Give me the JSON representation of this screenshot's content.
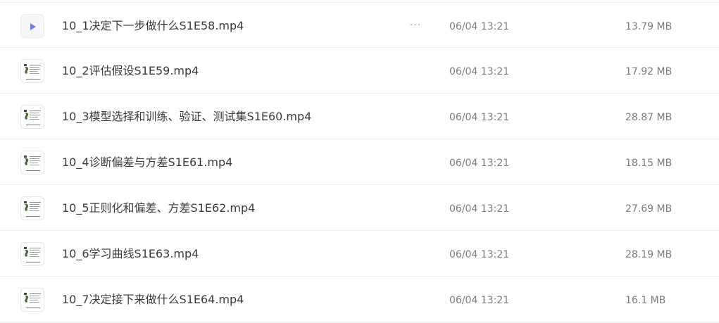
{
  "files": [
    {
      "name": "10_1决定下一步做什么S1E58.mp4",
      "date": "06/04 13:21",
      "size": "13.79 MB",
      "thumb_icon": "video-play-icon",
      "more_label": "···"
    },
    {
      "name": "10_2评估假设S1E59.mp4",
      "date": "06/04 13:21",
      "size": "17.92 MB",
      "thumb_icon": "video-thumbnail-icon"
    },
    {
      "name": "10_3模型选择和训练、验证、测试集S1E60.mp4",
      "date": "06/04 13:21",
      "size": "28.87 MB",
      "thumb_icon": "video-thumbnail-icon"
    },
    {
      "name": "10_4诊断偏差与方差S1E61.mp4",
      "date": "06/04 13:21",
      "size": "18.15 MB",
      "thumb_icon": "video-thumbnail-icon"
    },
    {
      "name": "10_5正则化和偏差、方差S1E62.mp4",
      "date": "06/04 13:21",
      "size": "27.69 MB",
      "thumb_icon": "video-thumbnail-icon"
    },
    {
      "name": "10_6学习曲线S1E63.mp4",
      "date": "06/04 13:21",
      "size": "28.19 MB",
      "thumb_icon": "video-thumbnail-icon"
    },
    {
      "name": "10_7决定接下来做什么S1E64.mp4",
      "date": "06/04 13:21",
      "size": "16.1 MB",
      "thumb_icon": "video-thumbnail-icon"
    }
  ],
  "colors": {
    "text_primary": "#3b3b3f",
    "text_secondary": "#7b7b82",
    "play_accent": "#6f7df6",
    "divider": "#f0f0f2"
  }
}
